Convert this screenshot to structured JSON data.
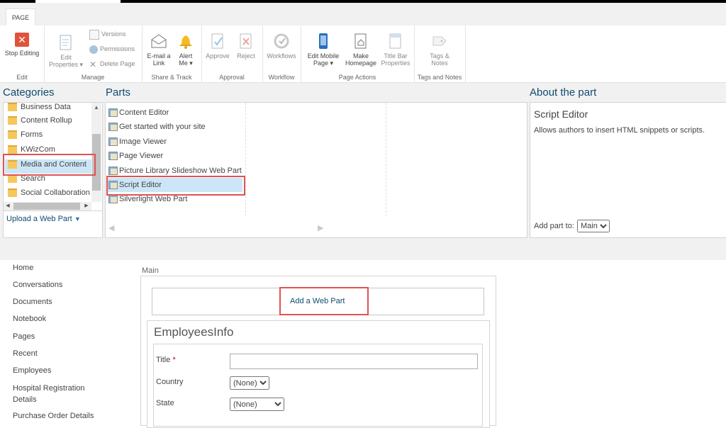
{
  "ribbon": {
    "tab": "PAGE",
    "edit_group": {
      "label": "Edit",
      "stop_editing": "Stop Editing"
    },
    "manage_group": {
      "label": "Manage",
      "edit_properties_1": "Edit",
      "edit_properties_2": "Properties",
      "versions": "Versions",
      "permissions": "Permissions",
      "delete_page": "Delete Page"
    },
    "share_group": {
      "label": "Share & Track",
      "email_1": "E-mail a",
      "email_2": "Link",
      "alert_1": "Alert",
      "alert_2": "Me"
    },
    "approval_group": {
      "label": "Approval",
      "approve": "Approve",
      "reject": "Reject"
    },
    "workflow_group": {
      "label": "Workflow",
      "workflows": "Workflows"
    },
    "actions_group": {
      "label": "Page Actions",
      "mobile_1": "Edit Mobile",
      "mobile_2": "Page",
      "home_1": "Make",
      "home_2": "Homepage",
      "title_1": "Title Bar",
      "title_2": "Properties"
    },
    "tags_group": {
      "label": "Tags and Notes",
      "tags_1": "Tags &",
      "tags_2": "Notes"
    }
  },
  "panel": {
    "categories_title": "Categories",
    "parts_title": "Parts",
    "about_title": "About the part",
    "categories": [
      "Business Data",
      "Content Rollup",
      "Forms",
      "KWizCom",
      "Media and Content",
      "Search",
      "Social Collaboration"
    ],
    "upload_label": "Upload a Web Part",
    "parts": [
      "Content Editor",
      "Get started with your site",
      "Image Viewer",
      "Page Viewer",
      "Picture Library Slideshow Web Part",
      "Script Editor",
      "Silverlight Web Part"
    ],
    "about_name": "Script Editor",
    "about_desc": "Allows authors to insert HTML snippets or scripts.",
    "add_part_label": "Add part to:",
    "add_part_zone": "Main"
  },
  "nav": [
    "Home",
    "Conversations",
    "Documents",
    "Notebook",
    "Pages",
    "Recent",
    "Employees",
    "Hospital Registration",
    "Details",
    "Purchase Order Details"
  ],
  "zone": {
    "label": "Main",
    "add_web_part": "Add a Web Part",
    "webpart_title": "EmployeesInfo",
    "fields": {
      "title_label": "Title",
      "required_mark": "*",
      "country_label": "Country",
      "country_value": "(None)",
      "state_label": "State",
      "state_value": "(None)"
    }
  },
  "colors": {
    "accent": "#0f4b6e",
    "highlight": "#e05252",
    "selection": "#cce6f7"
  }
}
